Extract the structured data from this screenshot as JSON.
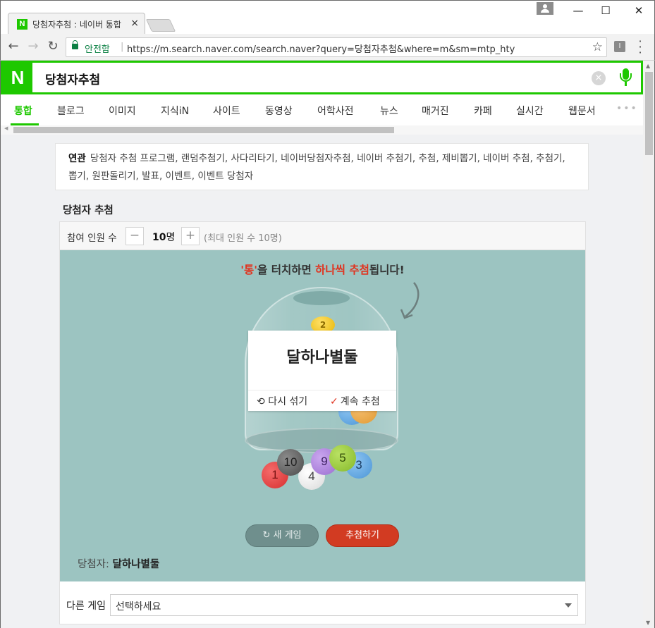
{
  "browser": {
    "tab_title": "당첨자추첨 : 네이버 통합",
    "tab_close": "×",
    "favicon": "N",
    "secure_label": "안전함",
    "url": "https://m.search.naver.com/search.naver?query=당첨자추첨&where=m&sm=mtp_hty",
    "window_controls": {
      "minimize": "—",
      "maximize": "☐",
      "close": "✕"
    }
  },
  "search": {
    "logo": "N",
    "query": "당첨자추첨",
    "clear": "×"
  },
  "tabs": [
    "통합",
    "블로그",
    "이미지",
    "지식iN",
    "사이트",
    "동영상",
    "어학사전",
    "뉴스",
    "매거진",
    "카페",
    "실시간",
    "웹문서"
  ],
  "tabs_more": "•••",
  "related": {
    "label": "연관",
    "keywords": "당첨자 추첨 프로그램, 랜덤추첨기, 사다리타기, 네이버당첨자추첨, 네이버 추첨기, 추첨, 제비뽑기, 네이버 추첨, 추첨기, 뽑기, 원판돌리기, 발표, 이벤트, 이벤트 당첨자"
  },
  "game": {
    "title": "당첨자 추첨",
    "count_label": "참여 인원 수",
    "minus": "−",
    "plus": "+",
    "count_value": "10",
    "count_unit": "명",
    "count_max": "(최대 인원 수 10명)",
    "hint_pre_quote": "'통'",
    "hint_mid": "을 터치하면 ",
    "hint_red": "하나씩 추첨",
    "hint_post": "됩니다!",
    "coin_label": "2",
    "result_name": "달하나별둘",
    "reshuffle": "다시 섞기",
    "continue": "계속 추첨",
    "balls": [
      "1",
      "4",
      "10",
      "9",
      "5",
      "3"
    ],
    "new_game": "새 게임",
    "draw": "추첨하기",
    "winner_label": "당첨자:",
    "winner_name": "달하나별둘",
    "other_label": "다른 게임",
    "select_value": "선택하세요"
  }
}
